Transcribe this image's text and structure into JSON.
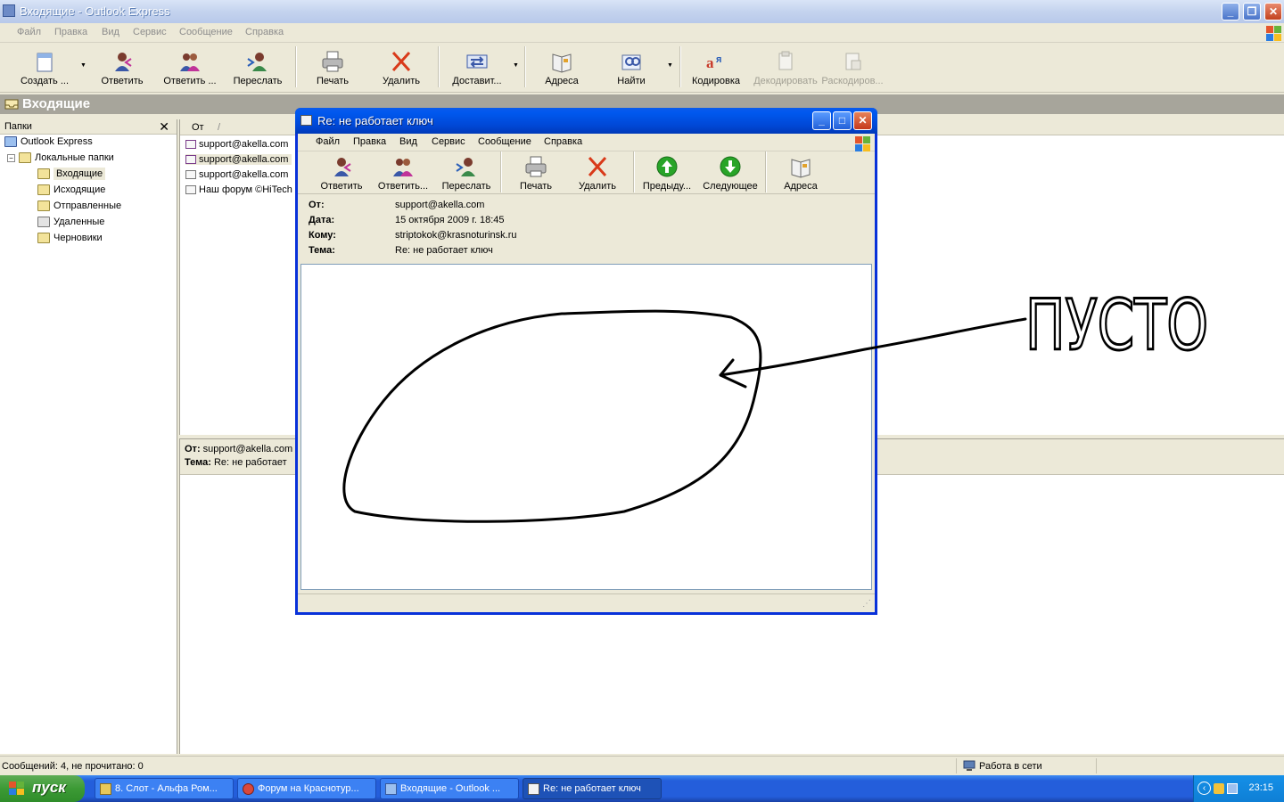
{
  "window": {
    "title": "Входящие - Outlook Express"
  },
  "menu": [
    "Файл",
    "Правка",
    "Вид",
    "Сервис",
    "Сообщение",
    "Справка"
  ],
  "toolbar": {
    "create": "Создать ...",
    "reply": "Ответить",
    "reply_all": "Ответить ...",
    "forward": "Переслать",
    "print": "Печать",
    "delete": "Удалить",
    "deliver": "Доставит...",
    "addresses": "Адреса",
    "find": "Найти",
    "encoding": "Кодировка",
    "decode": "Декодировать",
    "decrypt": "Раскодиров..."
  },
  "folder_header": "Входящие",
  "folders_pane": {
    "title": "Папки",
    "items": {
      "root": "Outlook Express",
      "local": "Локальные папки",
      "inbox": "Входящие",
      "outbox": "Исходящие",
      "sent": "Отправленные",
      "deleted": "Удаленные",
      "drafts": "Черновики"
    }
  },
  "message_list": {
    "col_from": "От",
    "col_sort": "/",
    "rows": [
      "support@akella.com",
      "support@akella.com",
      "support@akella.com",
      "Наш форум ©HiTech"
    ]
  },
  "preview": {
    "from_label": "От:",
    "from_value": "support@akella.com",
    "subject_label": "Тема:",
    "subject_value": "Re: не работает"
  },
  "status": {
    "messages": "Сообщений: 4, не прочитано: 0",
    "online": "Работа в сети"
  },
  "message_window": {
    "title": "Re: не работает ключ",
    "toolbar": {
      "reply": "Ответить",
      "reply_all": "Ответить...",
      "forward": "Переслать",
      "print": "Печать",
      "delete": "Удалить",
      "prev": "Предыду...",
      "next": "Следующее",
      "addresses": "Адреса"
    },
    "headers": {
      "from_label": "От:",
      "from_value": "support@akella.com",
      "date_label": "Дата:",
      "date_value": "15 октября 2009 г.  18:45",
      "to_label": "Кому:",
      "to_value": "striptokok@krasnoturinsk.ru",
      "subject_label": "Тема:",
      "subject_value": "Re: не работает ключ"
    }
  },
  "annotation": {
    "text": "ПУСТО"
  },
  "taskbar": {
    "start": "пуск",
    "tasks": [
      "8. Слот - Альфа Ром...",
      "Форум на Краснотур...",
      "Входящие - Outlook ...",
      "Re: не работает ключ"
    ],
    "clock": "23:15"
  },
  "colors": {
    "xp_blue": "#0831d9",
    "delete_red": "#d93a1a",
    "nav_green": "#28a428",
    "annotation_ink": "#000000"
  }
}
